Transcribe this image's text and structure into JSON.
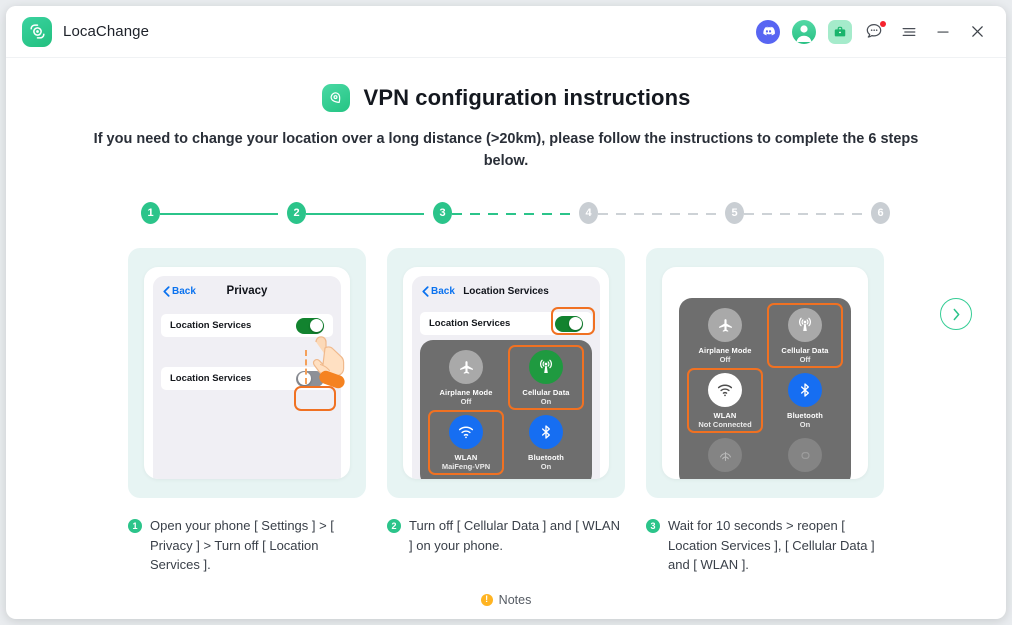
{
  "window": {
    "app_name": "LocaChange",
    "logo_icon": "locachange-logo-icon",
    "toolbar_icons": [
      "discord-icon",
      "user-avatar-icon",
      "briefcase-icon",
      "chat-bubble-icon",
      "menu-icon",
      "minimize-icon",
      "close-icon"
    ]
  },
  "header": {
    "badge_icon": "rocket-icon",
    "title": "VPN configuration instructions",
    "subtitle": "If you need to change your location over a long distance (>20km), please follow the instructions to complete the 6 steps below."
  },
  "stepper": {
    "steps": [
      {
        "label": "1",
        "state": "done"
      },
      {
        "label": "2",
        "state": "done"
      },
      {
        "label": "3",
        "state": "current"
      },
      {
        "label": "4",
        "state": "pending"
      },
      {
        "label": "5",
        "state": "pending"
      },
      {
        "label": "6",
        "state": "pending"
      }
    ]
  },
  "cards": [
    {
      "ios": {
        "back_label": "Back",
        "nav_title": "Privacy",
        "rows": [
          {
            "label": "Location Services",
            "toggle": "on",
            "highlight": false
          },
          {
            "label": "Location Services",
            "toggle": "off",
            "highlight": true
          }
        ]
      }
    },
    {
      "ios": {
        "back_label": "Back",
        "nav_title": "Location Services",
        "rows": [
          {
            "label": "Location Services",
            "toggle": "on",
            "highlight": true
          }
        ]
      },
      "control_center": [
        {
          "icon": "airplane-icon",
          "name": "Airplane Mode",
          "state": "Off",
          "style": "gray",
          "highlight": false
        },
        {
          "icon": "cellular-data-icon",
          "name": "Cellular Data",
          "state": "On",
          "style": "green",
          "highlight": true
        },
        {
          "icon": "wifi-icon",
          "name": "WLAN",
          "state": "MaiFeng-VPN",
          "style": "blue",
          "highlight": true
        },
        {
          "icon": "bluetooth-icon",
          "name": "Bluetooth",
          "state": "On",
          "style": "blue",
          "highlight": false
        }
      ]
    },
    {
      "control_center": [
        {
          "icon": "airplane-icon",
          "name": "Airplane Mode",
          "state": "Off",
          "style": "gray",
          "highlight": false
        },
        {
          "icon": "cellular-data-icon",
          "name": "Cellular Data",
          "state": "Off",
          "style": "gray",
          "highlight": true
        },
        {
          "icon": "wifi-icon",
          "name": "WLAN",
          "state": "Not Connected",
          "style": "white",
          "highlight": true
        },
        {
          "icon": "bluetooth-icon",
          "name": "Bluetooth",
          "state": "On",
          "style": "blue",
          "highlight": false
        },
        {
          "icon": "airdrop-icon",
          "name": "",
          "state": "",
          "style": "dim",
          "highlight": false
        },
        {
          "icon": "personal-hotspot-icon",
          "name": "",
          "state": "",
          "style": "dim",
          "highlight": false
        }
      ]
    }
  ],
  "captions": [
    {
      "num": "1",
      "text": "Open your phone [ Settings ] > [ Privacy ] > Turn off [ Location Services ]."
    },
    {
      "num": "2",
      "text": "Turn off [ Cellular Data ] and [ WLAN ] on your phone."
    },
    {
      "num": "3",
      "text": "Wait for 10 seconds > reopen [ Location Services ], [ Cellular Data ] and [ WLAN ]."
    }
  ],
  "next_button": {
    "icon": "chevron-right-icon"
  },
  "notes": {
    "icon": "warning-icon",
    "label": "Notes"
  },
  "colors": {
    "accent_green": "#2bc48a",
    "highlight_orange": "#f07122",
    "ios_blue": "#0a72ef",
    "card_bg": "#e7f4f3",
    "notes_yellow": "#ffb422"
  }
}
